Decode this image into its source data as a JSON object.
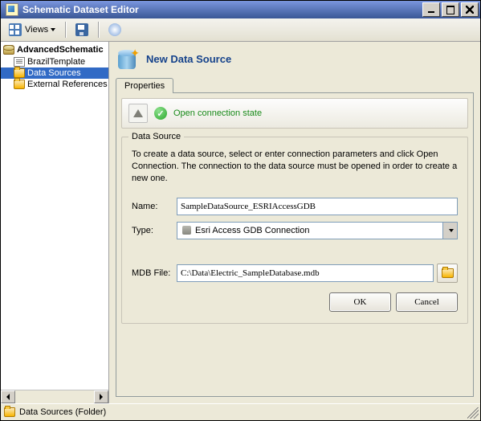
{
  "window": {
    "title": "Schematic Dataset Editor"
  },
  "toolbar": {
    "views_label": "Views"
  },
  "tree": {
    "root": "AdvancedSchematic",
    "items": [
      {
        "label": "BrazilTemplate",
        "type": "doc",
        "selected": false
      },
      {
        "label": "Data Sources",
        "type": "folder",
        "selected": true
      },
      {
        "label": "External References",
        "type": "folder",
        "selected": false
      }
    ]
  },
  "header": {
    "title": "New Data Source"
  },
  "tabs": {
    "properties": "Properties"
  },
  "status": {
    "text": "Open connection state"
  },
  "datasource": {
    "legend": "Data Source",
    "help": "To create a data source, select or enter connection parameters and click Open Connection.  The connection to the data source must be opened in order to create a new one.",
    "name_label": "Name:",
    "name_value": "SampleDataSource_ESRIAccessGDB",
    "type_label": "Type:",
    "type_value": "Esri Access GDB Connection",
    "mdb_label": "MDB File:",
    "mdb_value": "C:\\Data\\Electric_SampleDatabase.mdb",
    "ok": "OK",
    "cancel": "Cancel"
  },
  "statusbar": {
    "text": "Data Sources (Folder)"
  }
}
